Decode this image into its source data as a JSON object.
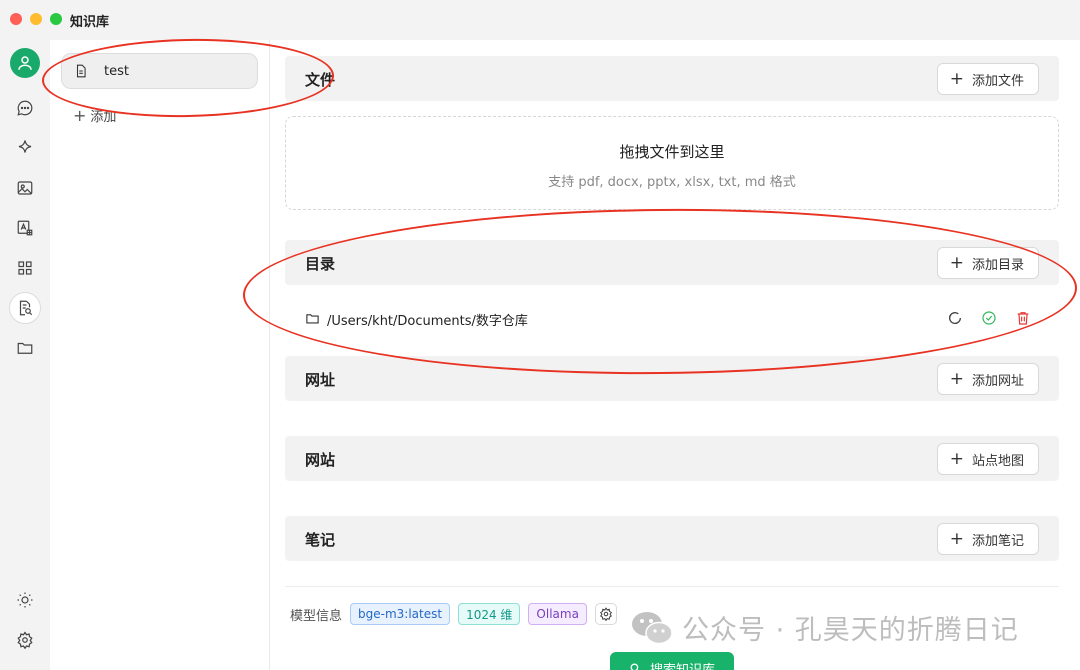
{
  "window": {
    "title": "知识库"
  },
  "icon_sidebar": {
    "items": [
      {
        "name": "avatar-icon"
      },
      {
        "name": "chat-icon"
      },
      {
        "name": "sparkle-icon"
      },
      {
        "name": "image-icon"
      },
      {
        "name": "translate-icon"
      },
      {
        "name": "apps-grid-icon"
      },
      {
        "name": "knowledge-base-icon",
        "active": true
      },
      {
        "name": "folder-icon"
      },
      {
        "name": "theme-sun-icon"
      },
      {
        "name": "settings-gear-icon"
      }
    ]
  },
  "kb_list": {
    "items": [
      {
        "label": "test",
        "icon": "document-icon"
      }
    ],
    "add_label": "添加"
  },
  "sections": {
    "files": {
      "title": "文件",
      "button": "添加文件",
      "dropzone_title": "拖拽文件到这里",
      "dropzone_hint": "支持 pdf, docx, pptx, xlsx, txt, md 格式"
    },
    "directories": {
      "title": "目录",
      "button": "添加目录",
      "items": [
        {
          "path": "/Users/kht/Documents/数字仓库"
        }
      ]
    },
    "urls": {
      "title": "网址",
      "button": "添加网址"
    },
    "websites": {
      "title": "网站",
      "button": "站点地图"
    },
    "notes": {
      "title": "笔记",
      "button": "添加笔记"
    }
  },
  "model_info": {
    "label": "模型信息",
    "model": "bge-m3:latest",
    "dimensions": "1024 维",
    "provider": "Ollama"
  },
  "search_button": "搜索知识库",
  "watermark": "公众号 · 孔昊天的折腾日记",
  "colors": {
    "accent_green": "#19b26b",
    "annotation_red": "#e83222",
    "check_green": "#2eb85c",
    "delete_red": "#e53935"
  }
}
